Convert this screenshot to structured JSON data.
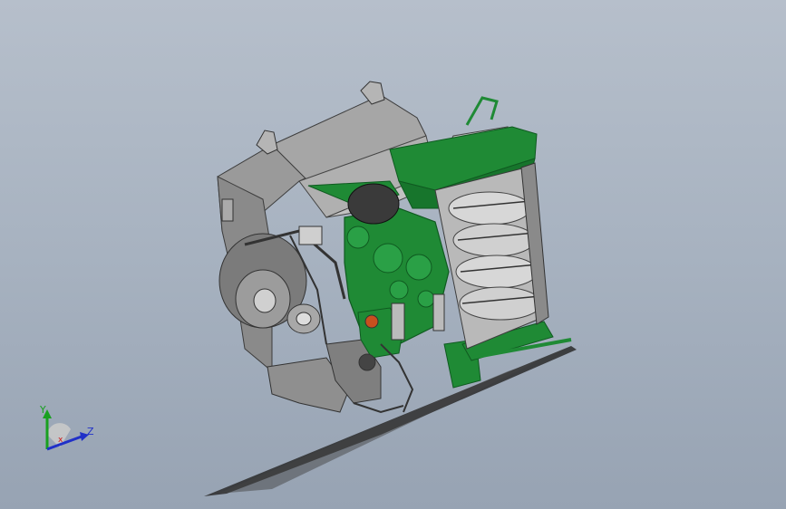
{
  "viewport": {
    "background_top": "#b6bfcb",
    "background_bottom": "#97a3b3"
  },
  "model": {
    "colors": {
      "housing_gray": "#8e8e8e",
      "housing_light": "#b4b4b4",
      "housing_dark": "#5a5a5a",
      "green_parts": "#1f8a35",
      "green_dark": "#0f5a20",
      "shadow": "#2a2a2a"
    }
  },
  "triad": {
    "y_label": "Y",
    "z_label": "Z",
    "x_label": "x",
    "y_color": "#18a020",
    "z_color": "#2030c8",
    "x_color": "#d01818"
  }
}
